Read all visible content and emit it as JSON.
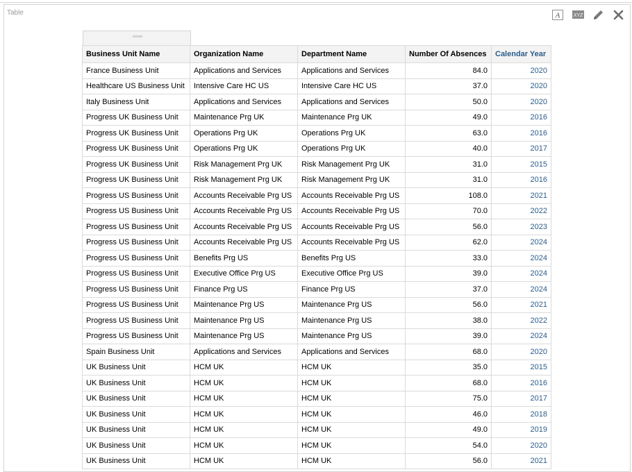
{
  "panel": {
    "title": "Table"
  },
  "toolbar": {
    "icons": [
      "font-icon",
      "xyz-icon",
      "pencil-icon",
      "close-icon"
    ],
    "xyz_text": "XYZ",
    "font_text": "A"
  },
  "table": {
    "headers": [
      "Business Unit Name",
      "Organization Name",
      "Department Name",
      "Number Of Absences",
      "Calendar Year"
    ],
    "rows": [
      [
        "France Business Unit",
        "Applications and Services",
        "Applications and Services",
        "84.0",
        "2020"
      ],
      [
        "Healthcare US Business Unit",
        "Intensive Care HC US",
        "Intensive Care HC US",
        "37.0",
        "2020"
      ],
      [
        "Italy Business Unit",
        "Applications and Services",
        "Applications and Services",
        "50.0",
        "2020"
      ],
      [
        "Progress UK Business Unit",
        "Maintenance Prg UK",
        "Maintenance Prg UK",
        "49.0",
        "2016"
      ],
      [
        "Progress UK Business Unit",
        "Operations Prg UK",
        "Operations Prg UK",
        "63.0",
        "2016"
      ],
      [
        "Progress UK Business Unit",
        "Operations Prg UK",
        "Operations Prg UK",
        "40.0",
        "2017"
      ],
      [
        "Progress UK Business Unit",
        "Risk Management Prg UK",
        "Risk Management Prg UK",
        "31.0",
        "2015"
      ],
      [
        "Progress UK Business Unit",
        "Risk Management Prg UK",
        "Risk Management Prg UK",
        "31.0",
        "2016"
      ],
      [
        "Progress US Business Unit",
        "Accounts Receivable Prg US",
        "Accounts Receivable Prg US",
        "108.0",
        "2021"
      ],
      [
        "Progress US Business Unit",
        "Accounts Receivable Prg US",
        "Accounts Receivable Prg US",
        "70.0",
        "2022"
      ],
      [
        "Progress US Business Unit",
        "Accounts Receivable Prg US",
        "Accounts Receivable Prg US",
        "56.0",
        "2023"
      ],
      [
        "Progress US Business Unit",
        "Accounts Receivable Prg US",
        "Accounts Receivable Prg US",
        "62.0",
        "2024"
      ],
      [
        "Progress US Business Unit",
        "Benefits Prg US",
        "Benefits Prg US",
        "33.0",
        "2024"
      ],
      [
        "Progress US Business Unit",
        "Executive Office Prg US",
        "Executive Office Prg US",
        "39.0",
        "2024"
      ],
      [
        "Progress US Business Unit",
        "Finance Prg US",
        "Finance Prg US",
        "37.0",
        "2024"
      ],
      [
        "Progress US Business Unit",
        "Maintenance Prg US",
        "Maintenance Prg US",
        "56.0",
        "2021"
      ],
      [
        "Progress US Business Unit",
        "Maintenance Prg US",
        "Maintenance Prg US",
        "38.0",
        "2022"
      ],
      [
        "Progress US Business Unit",
        "Maintenance Prg US",
        "Maintenance Prg US",
        "39.0",
        "2024"
      ],
      [
        "Spain Business Unit",
        "Applications and Services",
        "Applications and Services",
        "68.0",
        "2020"
      ],
      [
        "UK Business Unit",
        "HCM UK",
        "HCM UK",
        "35.0",
        "2015"
      ],
      [
        "UK Business Unit",
        "HCM UK",
        "HCM UK",
        "68.0",
        "2016"
      ],
      [
        "UK Business Unit",
        "HCM UK",
        "HCM UK",
        "75.0",
        "2017"
      ],
      [
        "UK Business Unit",
        "HCM UK",
        "HCM UK",
        "46.0",
        "2018"
      ],
      [
        "UK Business Unit",
        "HCM UK",
        "HCM UK",
        "49.0",
        "2019"
      ],
      [
        "UK Business Unit",
        "HCM UK",
        "HCM UK",
        "54.0",
        "2020"
      ],
      [
        "UK Business Unit",
        "HCM UK",
        "HCM UK",
        "56.0",
        "2021"
      ]
    ]
  },
  "colors": {
    "year_link": "#2b5c8a",
    "header_bg": "#f3f3f3",
    "grid": "#dadada"
  }
}
